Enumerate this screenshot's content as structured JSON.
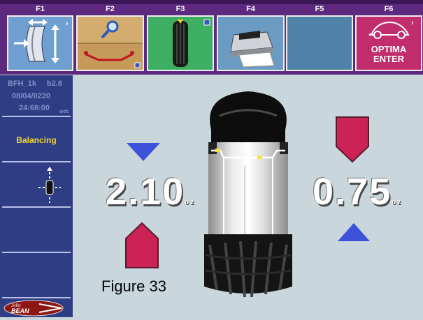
{
  "function_keys": [
    {
      "key": "F1"
    },
    {
      "key": "F2"
    },
    {
      "key": "F3"
    },
    {
      "key": "F4"
    },
    {
      "key": "F5"
    },
    {
      "key": "F6",
      "line1": "OPTIMA",
      "line2": "ENTER"
    }
  ],
  "info_panel": {
    "machine": "BFH_1k",
    "version": "b2.6",
    "date": "08/04/0220",
    "time": "24:68:00",
    "suffix": "wdc"
  },
  "sidebar": {
    "mode_label": "Balancing"
  },
  "readouts": {
    "left_value": "2.10",
    "left_unit": "oz",
    "right_value": "0.75",
    "right_unit": "oz"
  },
  "caption": "Figure 33",
  "logo_text": "John BEAN",
  "colors": {
    "topbar": "#5d2a7f",
    "sidebar": "#2e3d84",
    "background": "#c9d7dd",
    "arrow_blue": "#3d52d8",
    "weight_red": "#cc2356"
  }
}
